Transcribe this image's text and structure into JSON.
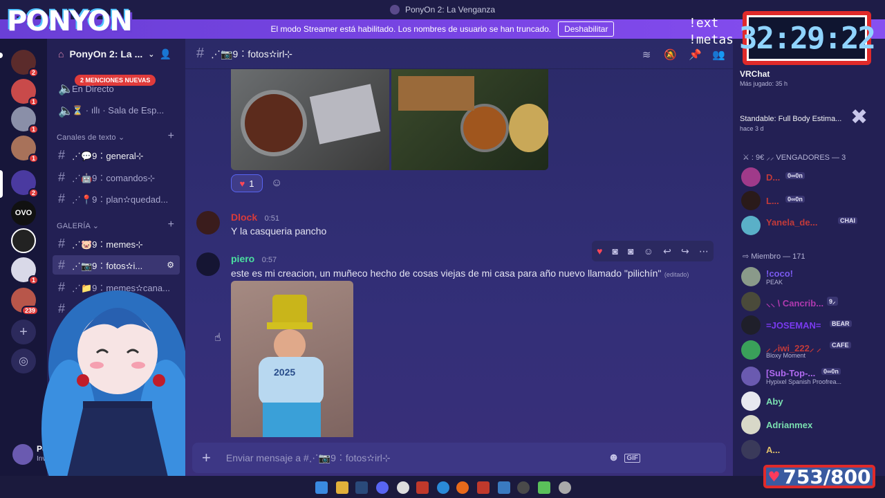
{
  "titlebar": {
    "title": "PonyOn 2: La Venganza"
  },
  "banner": {
    "text": "El modo Streamer está habilitado. Los nombres de usuario se han truncado.",
    "button": "Deshabilitar"
  },
  "overlay": {
    "logo": "PONYON",
    "timer": "32:29:22",
    "ext": "!ext",
    "metas": "!metas",
    "counter": "753/800"
  },
  "rail": {
    "servers": [
      {
        "badge": "65"
      },
      {
        "badge": "2"
      },
      {
        "badge": "1"
      },
      {
        "badge": "1"
      },
      {
        "badge": "1"
      },
      {
        "badge": "2"
      },
      {
        "badge": ""
      },
      {
        "badge": ""
      },
      {
        "badge": "1"
      },
      {
        "badge": "239"
      }
    ]
  },
  "sidebar": {
    "guild_name": "PonyOn 2: La ...",
    "mentions_pill": "2 MENCIONES NUEVAS",
    "voice": [
      {
        "label": "En Directo"
      },
      {
        "label": "⏳ · ıllı · Sala de Esp..."
      }
    ],
    "cat_text": "Canales de texto",
    "cat_gallery": "GALERÍA",
    "channels_text": [
      {
        "label": "⋰💬9︰general⊹"
      },
      {
        "label": "⋰🤖9︰comandos⊹"
      },
      {
        "label": "⋰📍9︰plan✫quedad..."
      }
    ],
    "channels_gallery": [
      {
        "label": "⋰🐷9︰memes⊹"
      },
      {
        "label": "⋰📷9︰fotos✫i..."
      },
      {
        "label": "⋰📁9︰memes✫cana..."
      }
    ],
    "user": {
      "name": "PonyO",
      "status": "Invisible"
    }
  },
  "chat": {
    "channel_name": "⋰📷9︰fotos✫irl⊹",
    "reaction_count": "1",
    "messages": [
      {
        "author": "Dlock",
        "time": "0:51",
        "text": "Y la casqueria pancho"
      },
      {
        "author": "piero",
        "time": "0:57",
        "text": "este es mi creacion, un muñeco hecho de cosas viejas de mi casa para año nuevo llamado \"pilichín\"",
        "edited": "(editado)"
      }
    ],
    "doll_year": "2025",
    "composer_placeholder": "Enviar mensaje a #⋰📷9︰fotos✫irl⊹"
  },
  "members": {
    "top_game": {
      "name": "VRChat",
      "sub": "Más jugado: 35 h"
    },
    "second_game": {
      "name": "Standable: Full Body Estima...",
      "sub": "hace 3 d"
    },
    "group1": "⚔ : 9€ ⸝⸝ VENGADORES — 3",
    "group2": "⇨ Miembro — 171",
    "list": [
      {
        "name": "D...",
        "tag": "0∞0n",
        "sub": ""
      },
      {
        "name": "L...",
        "tag": "0∞0n",
        "sub": ""
      },
      {
        "name": "Yanela_de...",
        "tag": "CHAI",
        "sub": ""
      },
      {
        "name": "!coco!",
        "tag": "",
        "sub": "PEAK"
      },
      {
        "name": "⸜⸜ \\ Cancrib...",
        "tag": "9⸝",
        "sub": ""
      },
      {
        "name": "=JOSEMAN=",
        "tag": "BEAR",
        "sub": ""
      },
      {
        "name": "⸝ ⸝iwi_222⸝ ⸝",
        "tag": "CAFE",
        "sub": "Bloxy Moment"
      },
      {
        "name": "[Sub-Top-...",
        "tag": "0∞0n",
        "sub": "Hypixel Spanish Proofrea..."
      },
      {
        "name": "Aby",
        "tag": "",
        "sub": ""
      },
      {
        "name": "Adrianmex",
        "tag": "",
        "sub": ""
      },
      {
        "name": "A...",
        "tag": "",
        "sub": ""
      }
    ]
  }
}
